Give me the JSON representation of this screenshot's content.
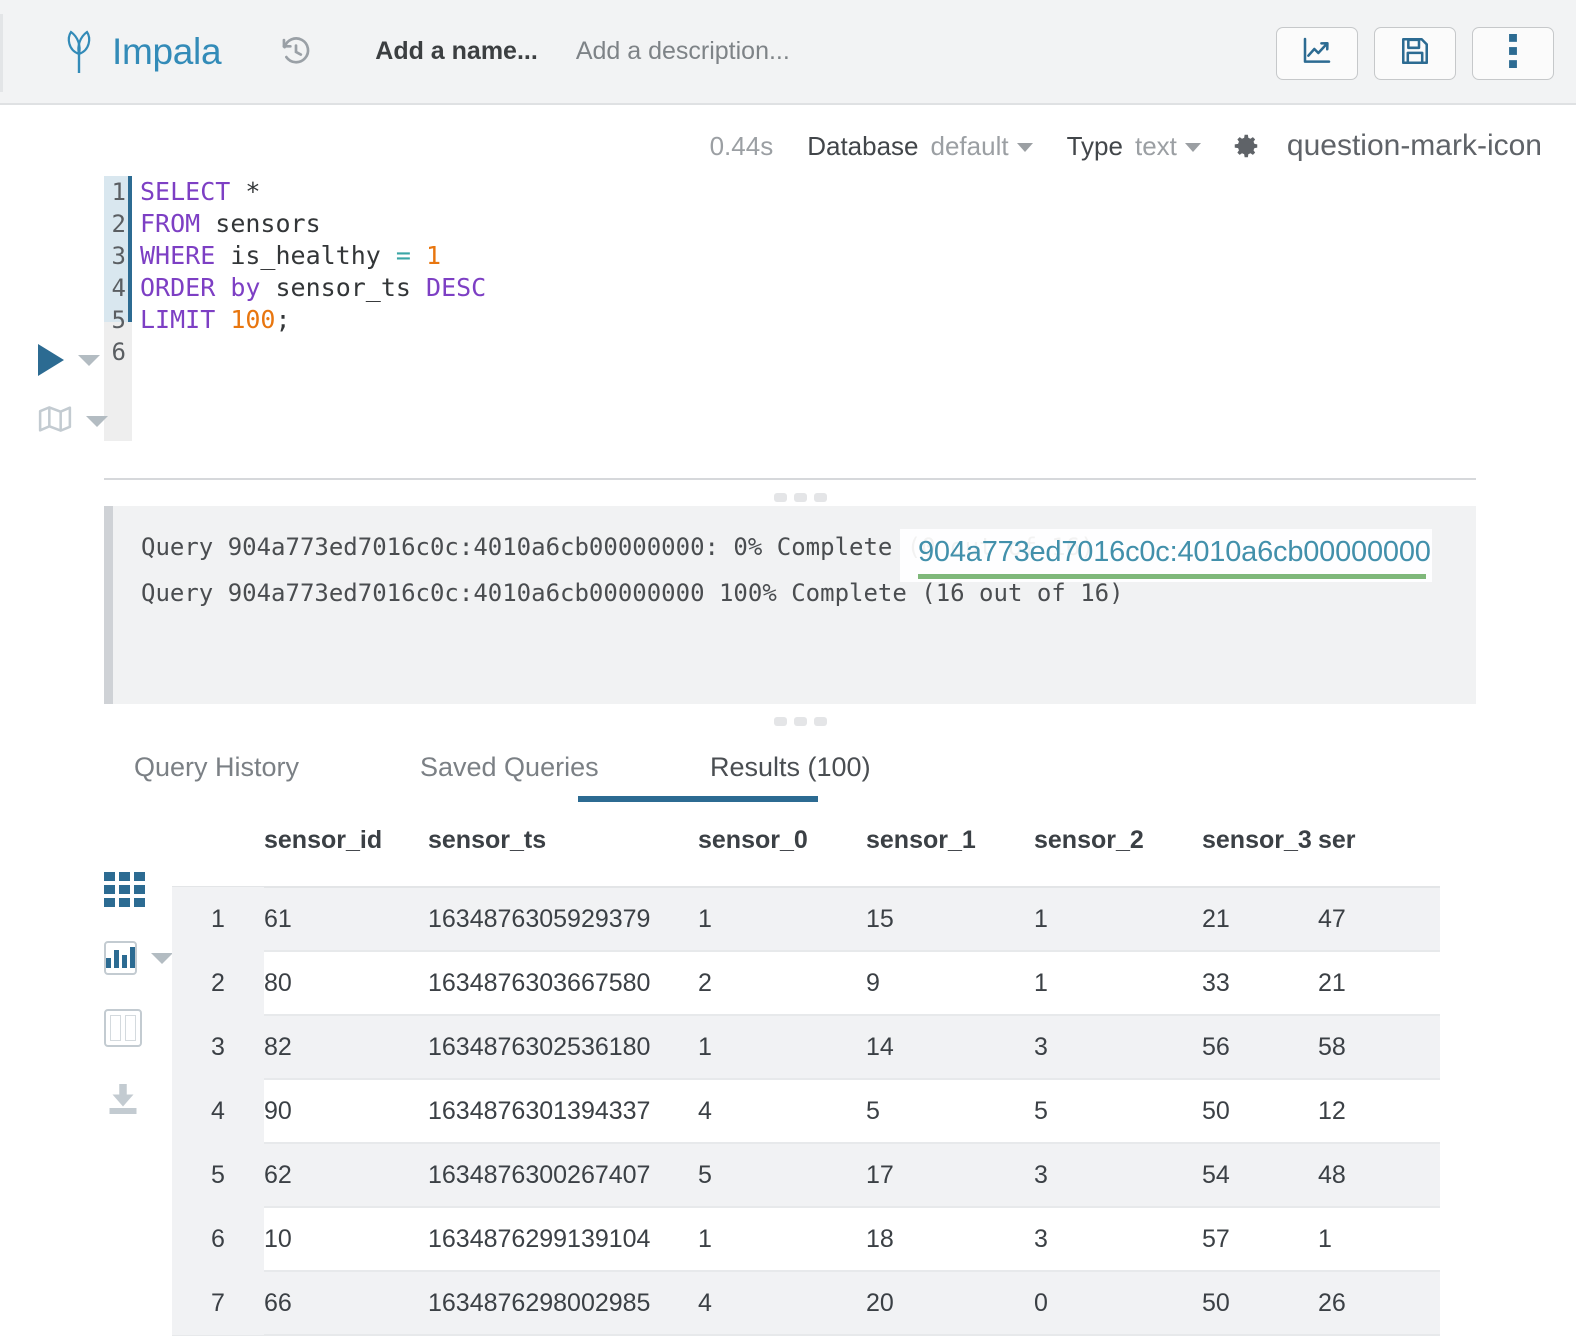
{
  "header": {
    "brand": "Impala",
    "logo_icon": "impala-leaf-logo",
    "history_icon": "history-clock-icon",
    "name_placeholder": "Add a name...",
    "description_placeholder": "Add a description...",
    "actions": [
      {
        "label": "chart-button",
        "icon": "line-chart-icon"
      },
      {
        "label": "save-button",
        "icon": "floppy-disk-save-icon"
      },
      {
        "label": "more-button",
        "icon": "vertical-ellipsis-icon"
      }
    ],
    "accent_color": "#2c6b92"
  },
  "meta": {
    "duration": "0.44s",
    "database_label": "Database",
    "database_value": "default",
    "type_label": "Type",
    "type_value": "text",
    "settings_icon": "gear-icon",
    "help_icon": "question-mark-icon"
  },
  "editor": {
    "run_icon": "play-triangle-icon",
    "explain_icon": "map-explain-icon",
    "line_numbers": [
      "1",
      "2",
      "3",
      "4",
      "5",
      "6"
    ],
    "lines": [
      [
        {
          "t": "SELECT",
          "c": "kw"
        },
        {
          "t": " *",
          "c": "pl"
        }
      ],
      [
        {
          "t": "FROM",
          "c": "kw"
        },
        {
          "t": " sensors",
          "c": "pl"
        }
      ],
      [
        {
          "t": "WHERE",
          "c": "kw"
        },
        {
          "t": " is_healthy ",
          "c": "pl"
        },
        {
          "t": "=",
          "c": "op"
        },
        {
          "t": " ",
          "c": "pl"
        },
        {
          "t": "1",
          "c": "num"
        }
      ],
      [
        {
          "t": "ORDER",
          "c": "kw"
        },
        {
          "t": " ",
          "c": "pl"
        },
        {
          "t": "by",
          "c": "kw"
        },
        {
          "t": " sensor_ts ",
          "c": "pl"
        },
        {
          "t": "DESC",
          "c": "kw"
        }
      ],
      [
        {
          "t": "LIMIT",
          "c": "kw"
        },
        {
          "t": " ",
          "c": "pl"
        },
        {
          "t": "100",
          "c": "num"
        },
        {
          "t": ";",
          "c": "pl"
        }
      ],
      []
    ]
  },
  "log": {
    "line1": "Query 904a773ed7016c0c:4010a6cb00000000: 0% Complete (0 out of 16)",
    "line2": "Query 904a773ed7016c0c:4010a6cb00000000 100% Complete (16 out of 16)",
    "overlay_link": "904a773ed7016c0c:4010a6cb00000000",
    "overlay_link_color": "#4290ab",
    "overlay_underline_color": "#7fb87a"
  },
  "tabs": [
    {
      "label": "Query History",
      "active": false
    },
    {
      "label": "Saved Queries",
      "active": false
    },
    {
      "label": "Results (100)",
      "active": true
    }
  ],
  "rail": [
    {
      "name": "grid-view-icon",
      "active": true
    },
    {
      "name": "chart-view-icon",
      "active": false
    },
    {
      "name": "columns-view-icon",
      "active": false
    },
    {
      "name": "download-icon",
      "active": false
    }
  ],
  "table": {
    "columns": [
      "sensor_id",
      "sensor_ts",
      "sensor_0",
      "sensor_1",
      "sensor_2",
      "sensor_3",
      "ser"
    ],
    "rows": [
      {
        "n": "1",
        "sensor_id": "61",
        "sensor_ts": "1634876305929379",
        "sensor_0": "1",
        "sensor_1": "15",
        "sensor_2": "1",
        "sensor_3": "21",
        "sensor_4": "47"
      },
      {
        "n": "2",
        "sensor_id": "80",
        "sensor_ts": "1634876303667580",
        "sensor_0": "2",
        "sensor_1": "9",
        "sensor_2": "1",
        "sensor_3": "33",
        "sensor_4": "21"
      },
      {
        "n": "3",
        "sensor_id": "82",
        "sensor_ts": "1634876302536180",
        "sensor_0": "1",
        "sensor_1": "14",
        "sensor_2": "3",
        "sensor_3": "56",
        "sensor_4": "58"
      },
      {
        "n": "4",
        "sensor_id": "90",
        "sensor_ts": "1634876301394337",
        "sensor_0": "4",
        "sensor_1": "5",
        "sensor_2": "5",
        "sensor_3": "50",
        "sensor_4": "12"
      },
      {
        "n": "5",
        "sensor_id": "62",
        "sensor_ts": "1634876300267407",
        "sensor_0": "5",
        "sensor_1": "17",
        "sensor_2": "3",
        "sensor_3": "54",
        "sensor_4": "48"
      },
      {
        "n": "6",
        "sensor_id": "10",
        "sensor_ts": "1634876299139104",
        "sensor_0": "1",
        "sensor_1": "18",
        "sensor_2": "3",
        "sensor_3": "57",
        "sensor_4": "1"
      },
      {
        "n": "7",
        "sensor_id": "66",
        "sensor_ts": "1634876298002985",
        "sensor_0": "4",
        "sensor_1": "20",
        "sensor_2": "0",
        "sensor_3": "50",
        "sensor_4": "26"
      }
    ]
  }
}
